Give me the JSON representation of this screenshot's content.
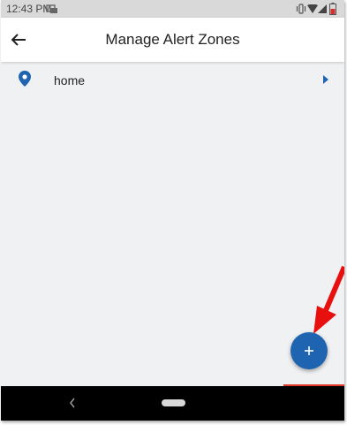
{
  "status_bar": {
    "time": "12:43 PM",
    "icons": [
      "notification-icon",
      "vibrate-icon",
      "wifi-icon",
      "signal-icon",
      "battery-icon"
    ]
  },
  "app_bar": {
    "title": "Manage Alert Zones",
    "back_icon": "arrow-left-icon"
  },
  "zones": [
    {
      "label": "home",
      "icon": "location-pin-icon"
    }
  ],
  "fab": {
    "icon": "plus-icon"
  },
  "nav_bar": {
    "icons": [
      "nav-back-icon",
      "home-pill"
    ]
  },
  "colors": {
    "accent": "#1e64b0",
    "background": "#f0f1f3",
    "annotation": "#e8100f"
  }
}
